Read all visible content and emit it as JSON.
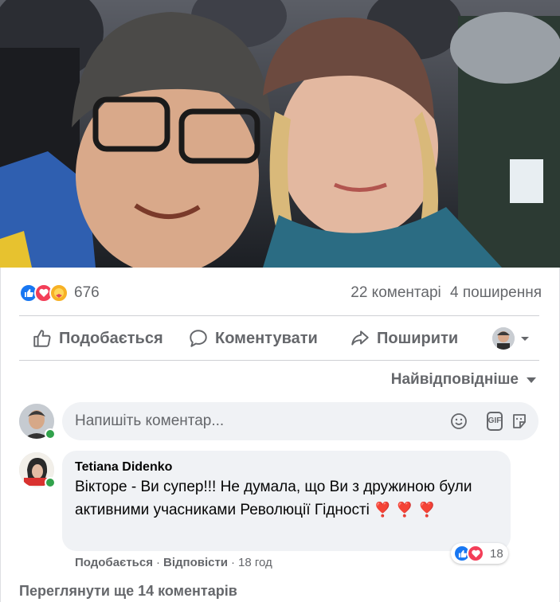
{
  "post": {
    "photo_icon": "crowd-selfie-photo",
    "reactions": {
      "icons": [
        "like-reaction-icon",
        "love-reaction-icon",
        "care-reaction-icon"
      ],
      "count": "676"
    },
    "stats": {
      "comments": "22 коментарі",
      "shares": "4 поширення"
    },
    "actions": {
      "like": "Подобається",
      "comment": "Коментувати",
      "share": "Поширити"
    }
  },
  "comments_section": {
    "sort_label": "Найвідповідніше",
    "composer": {
      "placeholder": "Напишіть коментар..."
    },
    "comments": [
      {
        "author": "Tetiana Didenko",
        "text": "Вікторе - Ви супер!!! Не думала, що Ви з дружиною були активними учасниками Революції Гідності",
        "reaction_count": "18",
        "like_label": "Подобається",
        "reply_label": "Відповісти",
        "time": "18 год"
      }
    ],
    "view_more": "Переглянути ще 14 коментарів"
  },
  "colors": {
    "like_blue": "#1877f2",
    "love_red": "#f33e58",
    "care_yellow": "#f7b125",
    "muted_text": "#65676b",
    "bubble_bg": "#f0f2f5",
    "online_green": "#31a24c"
  }
}
